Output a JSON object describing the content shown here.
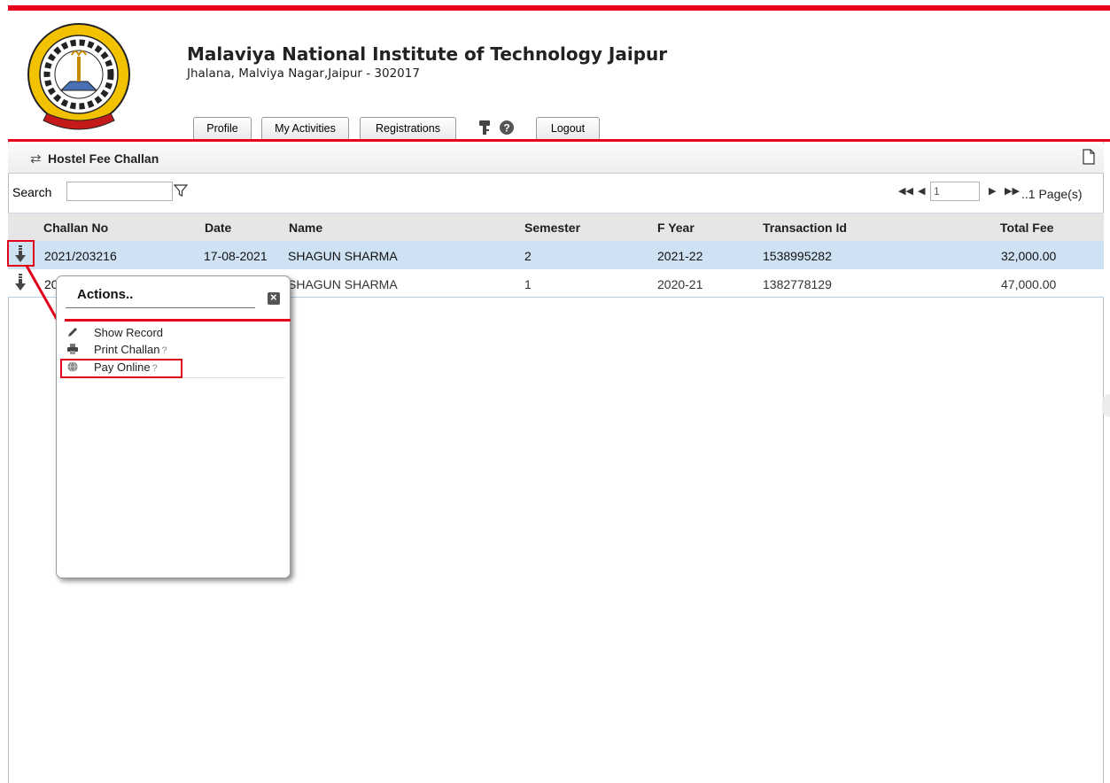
{
  "institute": {
    "name": "Malaviya National Institute of Technology Jaipur",
    "address": "Jhalana, Malviya Nagar,Jaipur - 302017"
  },
  "tabs": [
    {
      "label": "Profile"
    },
    {
      "label": "My Activities"
    },
    {
      "label": "Registrations"
    },
    {
      "label": "Logout"
    }
  ],
  "panel": {
    "title": "Hostel Fee Challan",
    "search_label": "Search",
    "search_value": "",
    "pager": {
      "page": "1",
      "pages_text": "..1 Page(s)"
    }
  },
  "table": {
    "columns": [
      "Challan No",
      "Date",
      "Name",
      "Semester",
      "F Year",
      "Transaction Id",
      "Total Fee"
    ],
    "rows": [
      {
        "challan_no": "2021/203216",
        "date": "17-08-2021",
        "name": "SHAGUN SHARMA",
        "semester": "2",
        "f_year": "2021-22",
        "transaction_id": "1538995282",
        "total_fee": "32,000.00",
        "selected": true
      },
      {
        "challan_no": "20",
        "date": "",
        "name": "SHAGUN SHARMA",
        "semester": "1",
        "f_year": "2020-21",
        "transaction_id": "1382778129",
        "total_fee": "47,000.00",
        "selected": false
      }
    ]
  },
  "actions_popup": {
    "title": "Actions..",
    "items": [
      {
        "label": "Show Record",
        "help": false
      },
      {
        "label": "Print Challan",
        "help": true
      },
      {
        "label": "Pay Online",
        "help": true
      }
    ],
    "help_glyph": "?"
  },
  "colors": {
    "accent_red": "#e8001c",
    "selected_row": "#cfe2f3",
    "header_bg": "#e6e6e6"
  },
  "icons": [
    "sync-icon",
    "document-icon",
    "filter-icon",
    "first-page-icon",
    "prev-page-icon",
    "next-page-icon",
    "last-page-icon",
    "key-icon",
    "help-icon",
    "down-arrow-icon",
    "close-icon",
    "pencil-icon",
    "printer-icon",
    "globe-icon"
  ]
}
